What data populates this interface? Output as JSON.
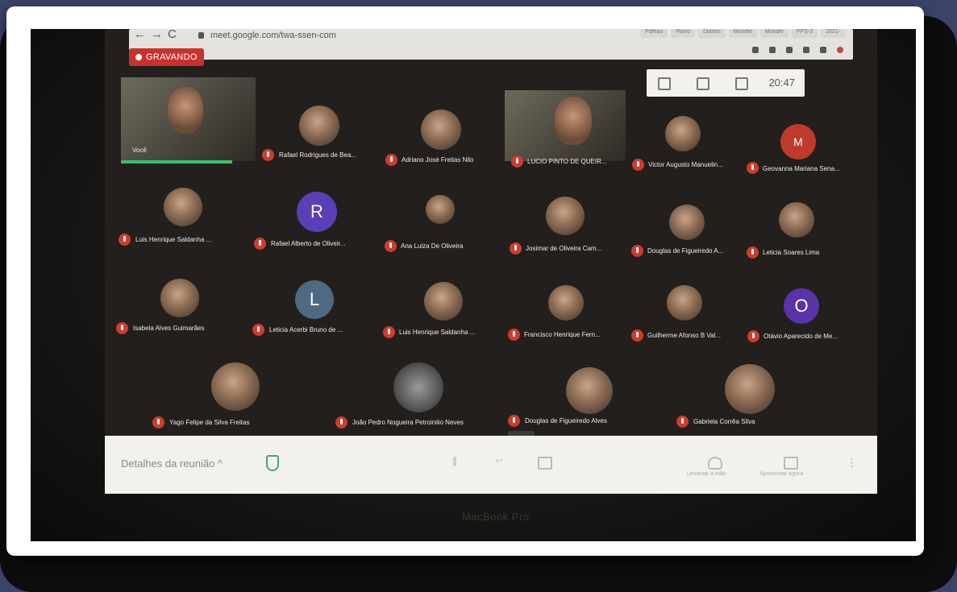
{
  "browser": {
    "url": "meet.google.com/twa-ssen-com",
    "tabs": [
      "Pdfeau",
      "Plano",
      "Diários",
      "Moodle",
      "Moodle",
      "PPS-3",
      "2021-"
    ]
  },
  "recording": {
    "label": "GRAVANDO"
  },
  "clock": "20:47",
  "self": {
    "name": "Você"
  },
  "participants": {
    "p1": "Rafael Rodrigues de Bea...",
    "p2": "Adriano José Freitas Nilo",
    "p3": "LUCIO PINTO DE QUEIR...",
    "p4": "Victor Augusto Manuelin...",
    "p5": "Geovanna Mariana Sena...",
    "p6": "Luis Henrique Saldanha ...",
    "p7": "Rafael Alberto de Oliveir...",
    "p8": "Ana Luiza De Oliveira",
    "p9": "Josimar de Oliveira Cam...",
    "p10": "Douglas de Figueiredo A...",
    "p11": "Leticia Soares Lima",
    "p12": "Isabela Alves Guimarães",
    "p13": "Leticia Acerbi Bruno de ...",
    "p14": "Luis Henrique Saldanha ...",
    "p15": "Francisco Henrique Fern...",
    "p16": "Guilherme Afonso B Val...",
    "p17": "Otávio Aparecido de Me...",
    "p18": "Yago Felipe da Silva Freitas",
    "p19": "João Pedro Nogueira Petroinilio Neves",
    "p20": "Douglas de Figueiredo Alves",
    "p21": "Gabriela Corrêa Silva"
  },
  "letters": {
    "m": "M",
    "r": "R",
    "l": "L",
    "o": "O"
  },
  "bottom": {
    "details": "Detalhes da reunião",
    "raise_hand": "Levantar a mão",
    "present": "Apresentar agora"
  },
  "laptop_brand": "MacBook Pro"
}
